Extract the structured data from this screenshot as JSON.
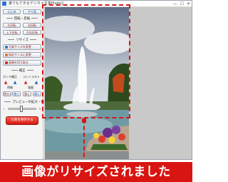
{
  "window": {
    "title": "誰でもできるデジカメ写真Photo2",
    "controls": [
      "—",
      "☐",
      "✕"
    ]
  },
  "toolbar": {
    "undo_label": "元に戻",
    "redo_label": "やり直"
  },
  "rotate": {
    "section_label": "回転・反転",
    "buttons": [
      "左回転",
      "右回転",
      "上下反転",
      "左右反転"
    ]
  },
  "resize": {
    "section_label": "リサイズ",
    "buttons": [
      "写真サイズを変更",
      "指定サイズに変更",
      "画像を切り取る"
    ]
  },
  "correction": {
    "section_label": "補正",
    "labels": [
      "ガンマ補正",
      "コントラスト"
    ],
    "sub_labels": [
      "明暗",
      "強弱"
    ],
    "buttons": [
      "明るく",
      "暗く",
      "強く",
      "弱く"
    ]
  },
  "preview_zoom": {
    "section_label": "プレビューの拡大・縮小",
    "value": 0.5
  },
  "save_button": {
    "label": "写真を保存する"
  },
  "banner": {
    "text": "画像がリサイズされました"
  },
  "colors": {
    "accent_red": "#d91512",
    "panel": "#f4f4f4",
    "preview_bg": "#c9c9c9"
  }
}
